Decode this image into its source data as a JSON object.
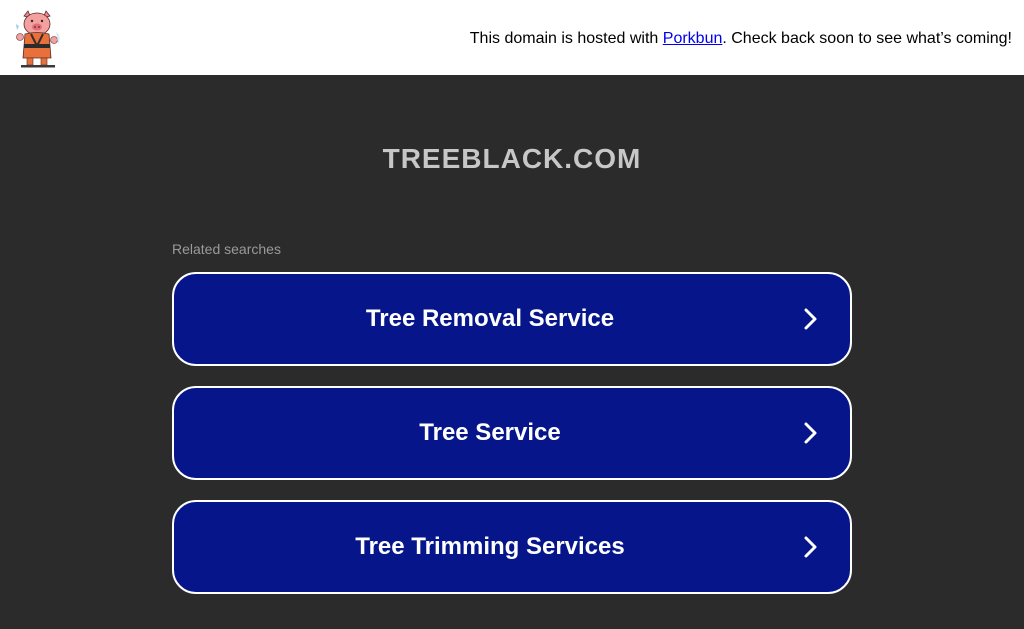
{
  "topbar": {
    "notice_prefix": "This domain is hosted with ",
    "link_text": "Porkbun",
    "notice_suffix": ". Check back soon to see what’s coming!",
    "logo_icon": "porkbun-pig-icon"
  },
  "main": {
    "domain": "TREEBLACK.COM",
    "related_label": "Related searches",
    "searches": [
      {
        "label": "Tree Removal Service",
        "icon": "chevron-right-icon"
      },
      {
        "label": "Tree Service",
        "icon": "chevron-right-icon"
      },
      {
        "label": "Tree Trimming Services",
        "icon": "chevron-right-icon"
      }
    ]
  },
  "colors": {
    "background": "#2b2b2b",
    "button": "#06168a",
    "button_border": "#ffffff",
    "title": "#c7c7c7",
    "link": "#0000ee"
  }
}
